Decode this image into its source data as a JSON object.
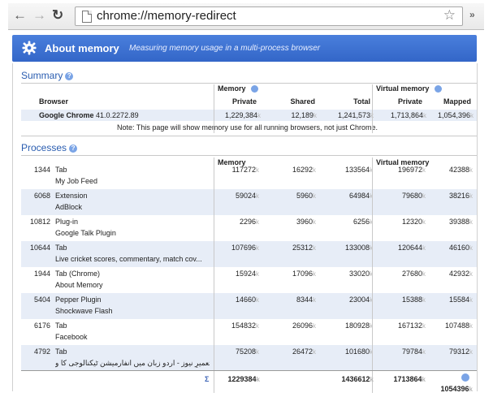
{
  "browser": {
    "url": "chrome://memory-redirect",
    "back_icon": "back-arrow-icon",
    "forward_icon": "forward-arrow-icon",
    "reload_icon": "reload-icon",
    "star_icon": "bookmark-star-icon",
    "more_label": "»"
  },
  "header": {
    "title": "About memory",
    "subtitle": "Measuring memory usage in a multi-process browser",
    "accent": "#3a70d1"
  },
  "summary": {
    "title": "Summary",
    "group_memory": "Memory",
    "group_virtual": "Virtual memory",
    "col_browser": "Browser",
    "col_private": "Private",
    "col_shared": "Shared",
    "col_total": "Total",
    "col_vprivate": "Private",
    "col_mapped": "Mapped",
    "row": {
      "browser": "Google Chrome",
      "version": "41.0.2272.89",
      "private": "1,229,384",
      "shared": "12,189",
      "total": "1,241,573",
      "vprivate": "1,713,864",
      "mapped": "1,054,396",
      "unit": "k"
    },
    "note": "Note: This page will show memory use for all running browsers, not just Chrome."
  },
  "processes": {
    "title": "Processes",
    "group_memory": "Memory",
    "group_virtual": "Virtual memory",
    "unit": "k",
    "rows": [
      {
        "pid": "1344",
        "type": "Tab",
        "desc": "My Job Feed",
        "private": "117272",
        "shared": "16292",
        "total": "133564",
        "vprivate": "196972",
        "mapped": "42388"
      },
      {
        "pid": "6068",
        "type": "Extension",
        "desc": "AdBlock",
        "private": "59024",
        "shared": "5960",
        "total": "64984",
        "vprivate": "79680",
        "mapped": "38216"
      },
      {
        "pid": "10812",
        "type": "Plug-in",
        "desc": "Google Talk Plugin",
        "private": "2296",
        "shared": "3960",
        "total": "6256",
        "vprivate": "12320",
        "mapped": "39388"
      },
      {
        "pid": "10644",
        "type": "Tab",
        "desc": "Live cricket scores, commentary, match cov...",
        "private": "107696",
        "shared": "25312",
        "total": "133008",
        "vprivate": "120644",
        "mapped": "46160"
      },
      {
        "pid": "1944",
        "type": "Tab (Chrome)",
        "desc": "About Memory",
        "private": "15924",
        "shared": "17096",
        "total": "33020",
        "vprivate": "27680",
        "mapped": "42932"
      },
      {
        "pid": "5404",
        "type": "Pepper Plugin",
        "desc": "Shockwave Flash",
        "private": "14660",
        "shared": "8344",
        "total": "23004",
        "vprivate": "15388",
        "mapped": "15584"
      },
      {
        "pid": "6176",
        "type": "Tab",
        "desc": "Facebook",
        "private": "154832",
        "shared": "26096",
        "total": "180928",
        "vprivate": "167132",
        "mapped": "107488"
      },
      {
        "pid": "4792",
        "type": "Tab",
        "desc": "ماہنامہ تعمیرِ نیوز - اردو زبان میں انفارمیشن ٹیکنالوجی کا و",
        "private": "75208",
        "shared": "26472",
        "total": "101680",
        "vprivate": "79784",
        "mapped": "79312"
      }
    ],
    "totals": {
      "sigma": "Σ",
      "private": "1229384",
      "total": "1436612",
      "vprivate": "1713864",
      "mapped": "1054396"
    }
  }
}
